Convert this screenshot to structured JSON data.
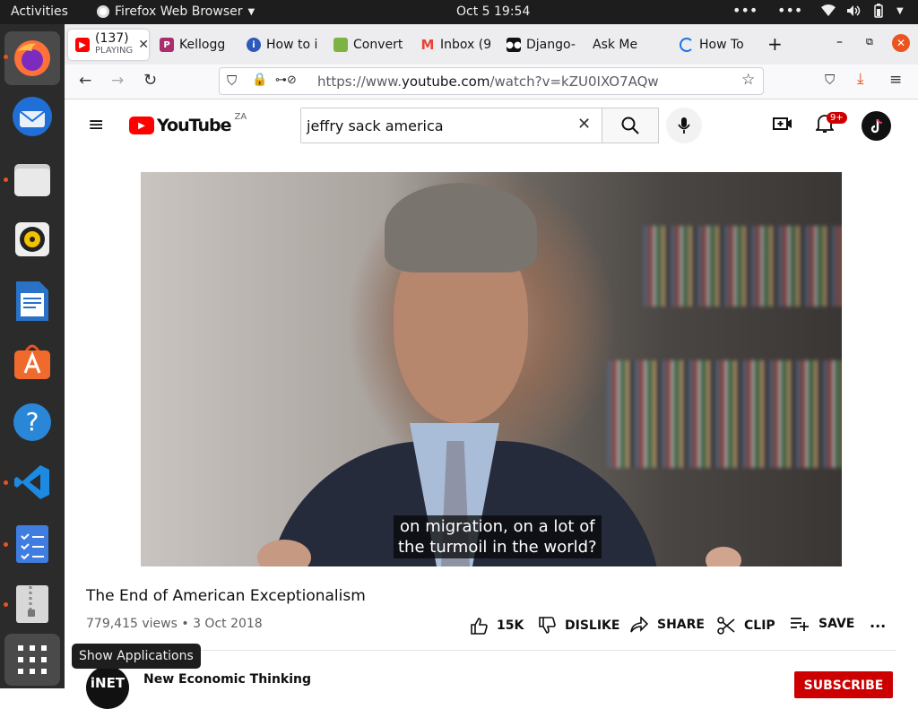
{
  "topbar": {
    "activities": "Activities",
    "app_name": "Firefox Web Browser",
    "clock": "Oct 5  19:54"
  },
  "dock": {
    "items": [
      "firefox",
      "thunderbird",
      "files",
      "rhythmbox",
      "libreoffice-writer",
      "software-center",
      "help",
      "vscode",
      "tasks",
      "archive-manager"
    ],
    "show_apps_tooltip": "Show Applications"
  },
  "tabs": [
    {
      "label": "(137)",
      "sublabel": "PLAYING",
      "icon": "youtube-icon",
      "color": "#ff0000"
    },
    {
      "label": "Kellogg",
      "icon": "pinterest-icon",
      "color": "#a82e6e"
    },
    {
      "label": "How to i",
      "icon": "howto-icon",
      "color": "#2d5bb9"
    },
    {
      "label": "Convert",
      "icon": "convert-icon",
      "color": "#7cb342"
    },
    {
      "label": "Inbox (9",
      "icon": "gmail-icon",
      "color": "#ea4335"
    },
    {
      "label": "Django-",
      "icon": "medium-icon",
      "color": "#111111"
    },
    {
      "label": "Ask Me",
      "icon": "",
      "color": ""
    },
    {
      "label": "How To",
      "icon": "loading-icon",
      "color": "#1a73e8"
    }
  ],
  "url": {
    "prefix": "https://www.",
    "domain": "youtube.com",
    "path": "/watch?v=kZU0IXO7AQw"
  },
  "youtube": {
    "logo_text": "YouTube",
    "region": "ZA",
    "search_value": "jeffry sack america",
    "notification_count": "9+",
    "video": {
      "caption_line1": "on migration, on a lot of",
      "caption_line2": "the turmoil in the world?",
      "title": "The End of American Exceptionalism",
      "views": "779,415 views",
      "date": "3 Oct 2018",
      "likes": "15K",
      "dislike_label": "DISLIKE",
      "share_label": "SHARE",
      "clip_label": "CLIP",
      "save_label": "SAVE"
    },
    "channel": {
      "name": "New Economic Thinking",
      "avatar_text": "iNET",
      "subscribe_label": "SUBSCRIBE"
    }
  }
}
